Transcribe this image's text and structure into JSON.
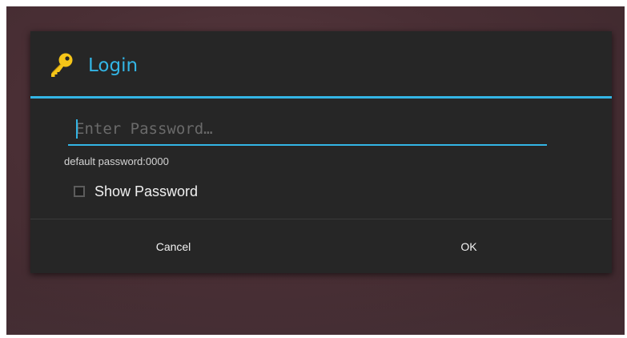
{
  "dialog": {
    "title": "Login",
    "icon": "key-icon",
    "accent_color": "#33b5e5",
    "background_color": "#262626"
  },
  "password_field": {
    "placeholder": "Enter Password…",
    "value": ""
  },
  "hint": "default password:0000",
  "show_password": {
    "label": "Show Password",
    "checked": false
  },
  "buttons": {
    "cancel": "Cancel",
    "ok": "OK"
  }
}
